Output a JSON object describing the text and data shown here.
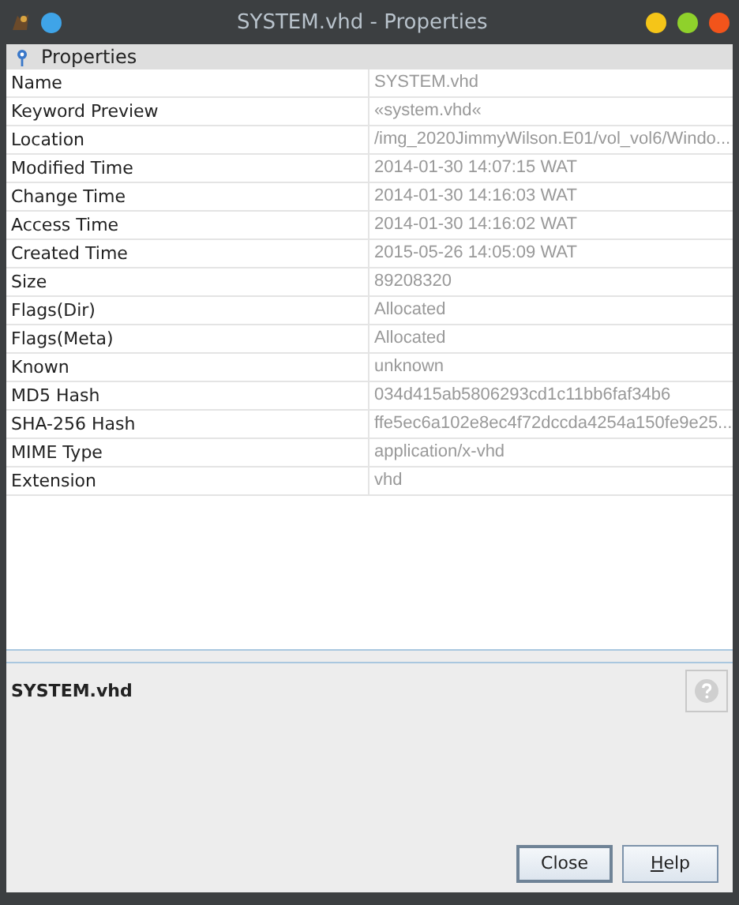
{
  "window": {
    "title": "SYSTEM.vhd - Properties"
  },
  "section": {
    "title": "Properties"
  },
  "properties": [
    {
      "name": "Name",
      "value": "SYSTEM.vhd"
    },
    {
      "name": "Keyword Preview",
      "value": "«system.vhd«"
    },
    {
      "name": "Location",
      "value": "/img_2020JimmyWilson.E01/vol_vol6/Windo..."
    },
    {
      "name": "Modified Time",
      "value": "2014-01-30 14:07:15 WAT"
    },
    {
      "name": "Change Time",
      "value": "2014-01-30 14:16:03 WAT"
    },
    {
      "name": "Access Time",
      "value": "2014-01-30 14:16:02 WAT"
    },
    {
      "name": "Created Time",
      "value": "2015-05-26 14:05:09 WAT"
    },
    {
      "name": "Size",
      "value": "89208320"
    },
    {
      "name": "Flags(Dir)",
      "value": "Allocated"
    },
    {
      "name": "Flags(Meta)",
      "value": "Allocated"
    },
    {
      "name": "Known",
      "value": "unknown"
    },
    {
      "name": "MD5 Hash",
      "value": "034d415ab5806293cd1c11bb6faf34b6"
    },
    {
      "name": "SHA-256 Hash",
      "value": "ffe5ec6a102e8ec4f72dccda4254a150fe9e25..."
    },
    {
      "name": "MIME Type",
      "value": "application/x-vhd"
    },
    {
      "name": "Extension",
      "value": "vhd"
    }
  ],
  "description": {
    "title": "SYSTEM.vhd"
  },
  "buttons": [
    {
      "label": "Close",
      "default": true,
      "first_letter_underlined": false
    },
    {
      "label": "Help",
      "default": false,
      "first_letter_underlined": true
    }
  ]
}
